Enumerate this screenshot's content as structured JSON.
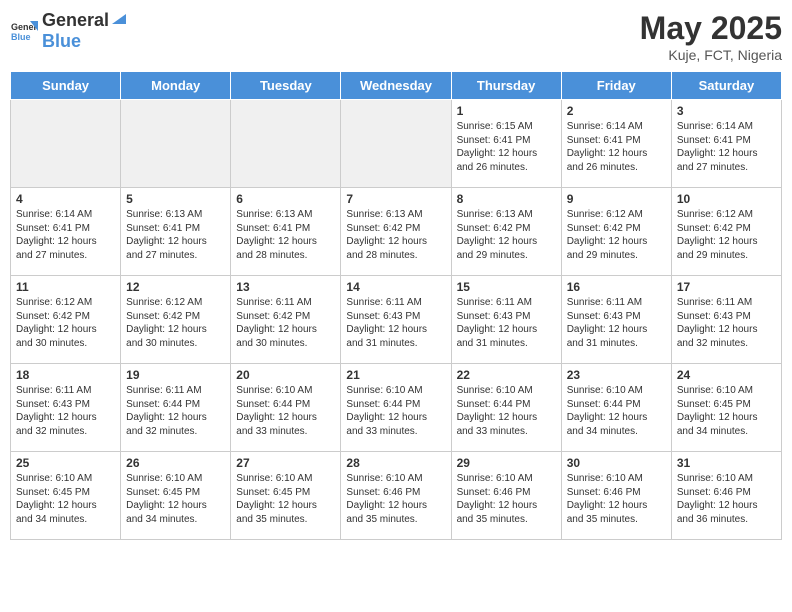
{
  "header": {
    "logo_general": "General",
    "logo_blue": "Blue",
    "title": "May 2025",
    "subtitle": "Kuje, FCT, Nigeria"
  },
  "days_of_week": [
    "Sunday",
    "Monday",
    "Tuesday",
    "Wednesday",
    "Thursday",
    "Friday",
    "Saturday"
  ],
  "weeks": [
    [
      {
        "day": "",
        "info": "",
        "shaded": true
      },
      {
        "day": "",
        "info": "",
        "shaded": true
      },
      {
        "day": "",
        "info": "",
        "shaded": true
      },
      {
        "day": "",
        "info": "",
        "shaded": true
      },
      {
        "day": "1",
        "info": "Sunrise: 6:15 AM\nSunset: 6:41 PM\nDaylight: 12 hours and 26 minutes."
      },
      {
        "day": "2",
        "info": "Sunrise: 6:14 AM\nSunset: 6:41 PM\nDaylight: 12 hours and 26 minutes."
      },
      {
        "day": "3",
        "info": "Sunrise: 6:14 AM\nSunset: 6:41 PM\nDaylight: 12 hours and 27 minutes."
      }
    ],
    [
      {
        "day": "4",
        "info": "Sunrise: 6:14 AM\nSunset: 6:41 PM\nDaylight: 12 hours and 27 minutes."
      },
      {
        "day": "5",
        "info": "Sunrise: 6:13 AM\nSunset: 6:41 PM\nDaylight: 12 hours and 27 minutes."
      },
      {
        "day": "6",
        "info": "Sunrise: 6:13 AM\nSunset: 6:41 PM\nDaylight: 12 hours and 28 minutes."
      },
      {
        "day": "7",
        "info": "Sunrise: 6:13 AM\nSunset: 6:42 PM\nDaylight: 12 hours and 28 minutes."
      },
      {
        "day": "8",
        "info": "Sunrise: 6:13 AM\nSunset: 6:42 PM\nDaylight: 12 hours and 29 minutes."
      },
      {
        "day": "9",
        "info": "Sunrise: 6:12 AM\nSunset: 6:42 PM\nDaylight: 12 hours and 29 minutes."
      },
      {
        "day": "10",
        "info": "Sunrise: 6:12 AM\nSunset: 6:42 PM\nDaylight: 12 hours and 29 minutes."
      }
    ],
    [
      {
        "day": "11",
        "info": "Sunrise: 6:12 AM\nSunset: 6:42 PM\nDaylight: 12 hours and 30 minutes."
      },
      {
        "day": "12",
        "info": "Sunrise: 6:12 AM\nSunset: 6:42 PM\nDaylight: 12 hours and 30 minutes."
      },
      {
        "day": "13",
        "info": "Sunrise: 6:11 AM\nSunset: 6:42 PM\nDaylight: 12 hours and 30 minutes."
      },
      {
        "day": "14",
        "info": "Sunrise: 6:11 AM\nSunset: 6:43 PM\nDaylight: 12 hours and 31 minutes."
      },
      {
        "day": "15",
        "info": "Sunrise: 6:11 AM\nSunset: 6:43 PM\nDaylight: 12 hours and 31 minutes."
      },
      {
        "day": "16",
        "info": "Sunrise: 6:11 AM\nSunset: 6:43 PM\nDaylight: 12 hours and 31 minutes."
      },
      {
        "day": "17",
        "info": "Sunrise: 6:11 AM\nSunset: 6:43 PM\nDaylight: 12 hours and 32 minutes."
      }
    ],
    [
      {
        "day": "18",
        "info": "Sunrise: 6:11 AM\nSunset: 6:43 PM\nDaylight: 12 hours and 32 minutes."
      },
      {
        "day": "19",
        "info": "Sunrise: 6:11 AM\nSunset: 6:44 PM\nDaylight: 12 hours and 32 minutes."
      },
      {
        "day": "20",
        "info": "Sunrise: 6:10 AM\nSunset: 6:44 PM\nDaylight: 12 hours and 33 minutes."
      },
      {
        "day": "21",
        "info": "Sunrise: 6:10 AM\nSunset: 6:44 PM\nDaylight: 12 hours and 33 minutes."
      },
      {
        "day": "22",
        "info": "Sunrise: 6:10 AM\nSunset: 6:44 PM\nDaylight: 12 hours and 33 minutes."
      },
      {
        "day": "23",
        "info": "Sunrise: 6:10 AM\nSunset: 6:44 PM\nDaylight: 12 hours and 34 minutes."
      },
      {
        "day": "24",
        "info": "Sunrise: 6:10 AM\nSunset: 6:45 PM\nDaylight: 12 hours and 34 minutes."
      }
    ],
    [
      {
        "day": "25",
        "info": "Sunrise: 6:10 AM\nSunset: 6:45 PM\nDaylight: 12 hours and 34 minutes."
      },
      {
        "day": "26",
        "info": "Sunrise: 6:10 AM\nSunset: 6:45 PM\nDaylight: 12 hours and 34 minutes."
      },
      {
        "day": "27",
        "info": "Sunrise: 6:10 AM\nSunset: 6:45 PM\nDaylight: 12 hours and 35 minutes."
      },
      {
        "day": "28",
        "info": "Sunrise: 6:10 AM\nSunset: 6:46 PM\nDaylight: 12 hours and 35 minutes."
      },
      {
        "day": "29",
        "info": "Sunrise: 6:10 AM\nSunset: 6:46 PM\nDaylight: 12 hours and 35 minutes."
      },
      {
        "day": "30",
        "info": "Sunrise: 6:10 AM\nSunset: 6:46 PM\nDaylight: 12 hours and 35 minutes."
      },
      {
        "day": "31",
        "info": "Sunrise: 6:10 AM\nSunset: 6:46 PM\nDaylight: 12 hours and 36 minutes."
      }
    ]
  ]
}
